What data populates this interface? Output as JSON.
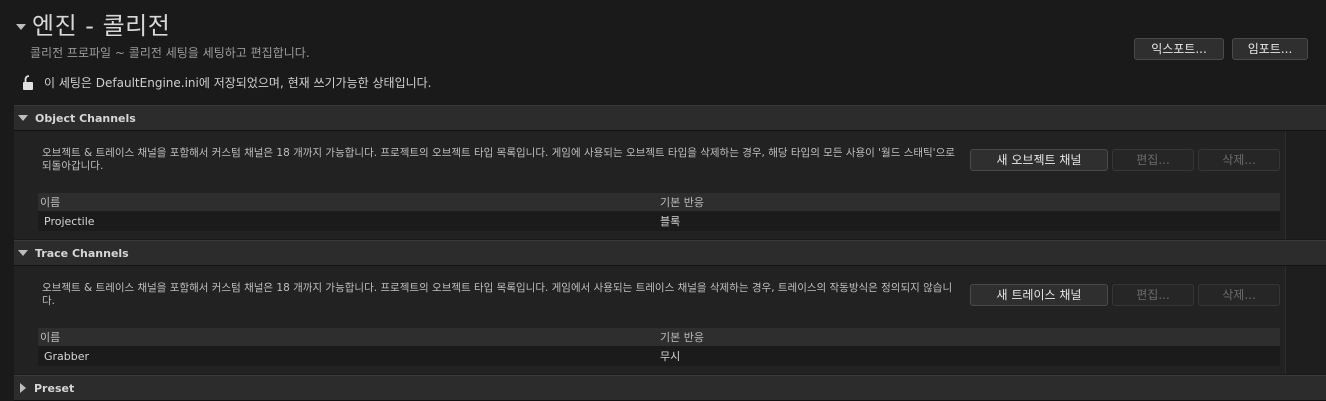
{
  "header": {
    "title": "엔진 - 콜리전",
    "subtitle": "콜리전 프로파일 ~ 콜리전 세팅을 세팅하고 편집합니다.",
    "export_label": "익스포트...",
    "import_label": "임포트...",
    "lock_text": "이 세팅은 DefaultEngine.ini에 저장되었으며, 현재 쓰기가능한 상태입니다."
  },
  "object_channels": {
    "title": "Object Channels",
    "description": "오브젝트 & 트레이스 채널을 포함해서 커스텀 채널은 18 개까지 가능합니다. 프로젝트의 오브젝트 타입 목록입니다. 게임에 사용되는 오브젝트 타입을 삭제하는 경우, 해당 타입의 모든 사용이 '월드 스태틱'으로 되돌아갑니다.",
    "new_label": "새 오브젝트 채널",
    "edit_label": "편집...",
    "delete_label": "삭제...",
    "col_name": "이름",
    "col_response": "기본 반응",
    "rows": [
      {
        "name": "Projectile",
        "response": "블록"
      }
    ]
  },
  "trace_channels": {
    "title": "Trace Channels",
    "description": "오브젝트 & 트레이스 채널을 포함해서 커스텀 채널은 18 개까지 가능합니다. 프로젝트의 오브젝트 타입 목록입니다. 게임에서 사용되는 트레이스 채널을 삭제하는 경우, 트레이스의 작동방식은 정의되지 않습니다.",
    "new_label": "새 트레이스 채널",
    "edit_label": "편집...",
    "delete_label": "삭제...",
    "col_name": "이름",
    "col_response": "기본 반응",
    "rows": [
      {
        "name": "Grabber",
        "response": "무시"
      }
    ]
  },
  "preset": {
    "title": "Preset"
  }
}
